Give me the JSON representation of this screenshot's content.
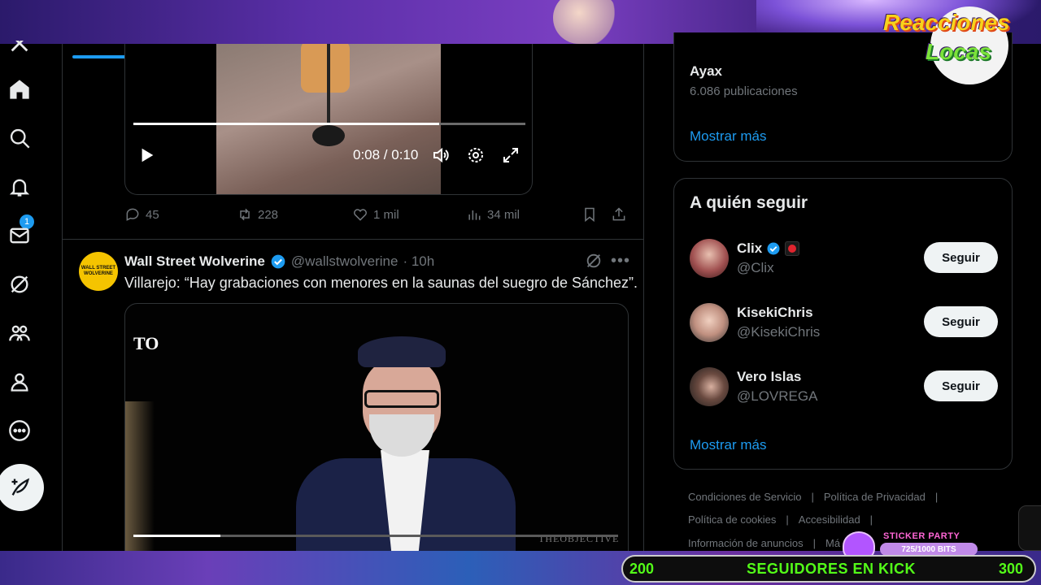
{
  "nav": {
    "notification_count": "1",
    "items": [
      "home-icon",
      "search-icon",
      "bell-icon",
      "mail-icon",
      "grok-icon",
      "communities-icon",
      "profile-icon",
      "more-icon"
    ]
  },
  "tweet1": {
    "video": {
      "time": "0:08 / 0:10",
      "progress": 0.78
    },
    "actions": {
      "replies": "45",
      "reposts": "228",
      "likes": "1 mil",
      "views": "34 mil"
    }
  },
  "tweet2": {
    "author": "Wall Street Wolverine",
    "avatar_text_1": "WALL STREET",
    "avatar_text_2": "WOLVERINE",
    "handle": "@wallstwolverine",
    "time": "· 10h",
    "text": "Villarejo: “Hay grabaciones con menores en la saunas del suegro de Sánchez”.",
    "video": {
      "logo": "TO",
      "watermark": "THEOBJECTIVE",
      "progress": 0.18
    }
  },
  "trends": {
    "item_name": "Ayax",
    "item_count": "6.086 publicaciones",
    "show_more": "Mostrar más"
  },
  "who_to_follow": {
    "title": "A quién seguir",
    "users": [
      {
        "name": "Clix",
        "handle": "@Clix",
        "button": "Seguir"
      },
      {
        "name": "KisekiChris",
        "handle": "@KisekiChris",
        "button": "Seguir"
      },
      {
        "name": "Vero Islas",
        "handle": "@LOVREGA",
        "button": "Seguir"
      }
    ],
    "show_more": "Mostrar más"
  },
  "footer": {
    "terms": "Condiciones de Servicio",
    "privacy": "Política de Privacidad",
    "cookies": "Política de cookies",
    "accessibility": "Accesibilidad",
    "ads": "Información de anuncios",
    "more": "Má",
    "sep": "|"
  },
  "overlay": {
    "brand_line1": "Reacciones",
    "brand_line2": "Locas",
    "sticker_label": "STICKER PARTY",
    "sticker_progress": "725/1000 BITS",
    "kick_start": "200",
    "kick_label": "SEGUIDORES EN KICK",
    "kick_end": "300"
  },
  "colors": {
    "accent": "#1d9bf0",
    "kick_green": "#53fc18"
  }
}
